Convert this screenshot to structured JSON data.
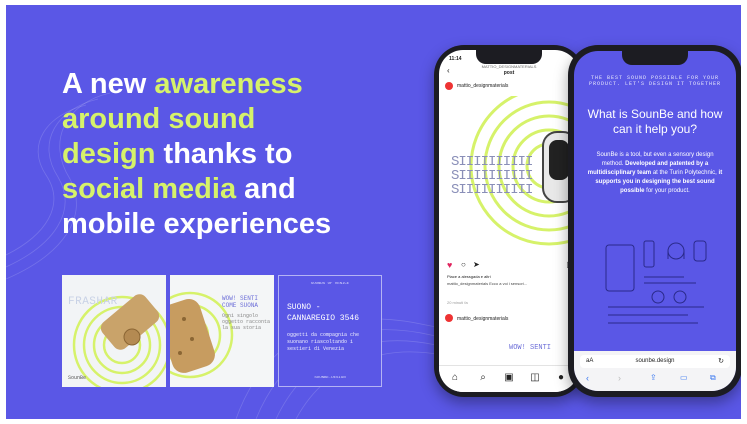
{
  "headline": {
    "line1_hl": "A new",
    "line1_accent": "awareness",
    "line2": "around sound",
    "line3_accent": "design",
    "line3_rest": "thanks to",
    "line4_accent": "social media",
    "line4_rest": "and",
    "line5": "mobile experiences"
  },
  "colors": {
    "background": "#5a57e6",
    "accent": "#d6f26a",
    "text": "#ffffff"
  },
  "thumbnails": [
    {
      "title": "FRASHAR",
      "caption": "SounBe"
    },
    {
      "title": "WOW! SENTI COME SUONA",
      "caption": "Ogni singolo oggetto racconta la sua storia"
    },
    {
      "header": "SOUNDS OF VENICE",
      "title": "SUONO - CANNAREGIO 3546",
      "body": "oggetti da compagnia che suonano riascoltando i sestieri di Venezia",
      "footer": "SOUNBE.DESIGN"
    }
  ],
  "phone1": {
    "time": "11:14",
    "account_header": "MATTIO_DESIGNMATERIALS",
    "post_label": "post",
    "username": "mattio_designmaterials",
    "art_text": "SIIIIIIIIII",
    "likes": "Piace a alessgada e altri",
    "caption": "mattio_designmaterials Ecco a voi i sensori... ",
    "time_ago": "20 minuti fa",
    "next_user": "mattio_designmaterials",
    "bottom_art": "WOW! SENTI"
  },
  "phone2": {
    "header_small": "THE BEST SOUND POSSIBLE FOR YOUR PRODUCT. LET'S DESIGN IT TOGETHER",
    "title": "What is SounBe and how can it help you?",
    "body_plain": "SounBe is a tool, but even a sensory design method.",
    "body_bold1": "Developed and patented by a multidisciplinary team",
    "body_plain2": "at the Turin Polytechnic,",
    "body_bold2": "it supports you in designing the best sound possible",
    "body_plain3": "for your product.",
    "address_aa": "aA",
    "address_url": "sounbe.design"
  },
  "icons": [
    "back-icon",
    "heart-icon",
    "comment-icon",
    "share-icon",
    "bookmark-icon",
    "home-icon",
    "search-icon",
    "reels-icon",
    "shop-icon",
    "reload-icon",
    "chevron-left-icon",
    "chevron-right-icon",
    "share-icon",
    "book-icon",
    "tabs-icon"
  ]
}
